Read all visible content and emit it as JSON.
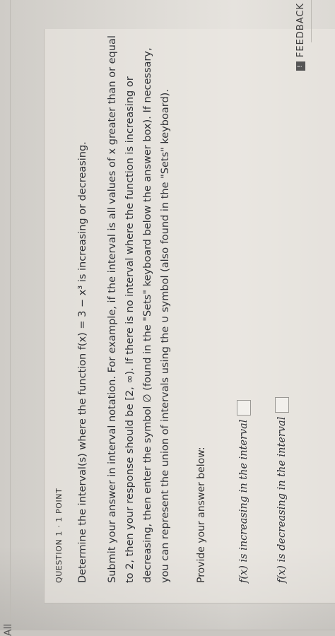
{
  "tab_label": "All",
  "question": {
    "label": "QUESTION 1 · 1 POINT",
    "prompt": "Determine the interval(s) where the function f(x) = 3 − x³ is increasing or decreasing.",
    "instructions": "Submit your answer in interval notation. For example, if the interval is all values of x greater than or equal to 2, then your response should be [2, ∞). If there is no interval where the function is increasing or decreasing, then enter the symbol ∅ (found in the \"Sets\" keyboard below the answer box). If necessary, you can represent the union of intervals using the ∪ symbol (also found in the \"Sets\" keyboard).",
    "provide_label": "Provide your answer below:",
    "answers": [
      {
        "label": "f(x) is increasing in the interval",
        "value": ""
      },
      {
        "label": "f(x) is decreasing in the interval",
        "value": ""
      }
    ]
  },
  "feedback": {
    "label": "FEEDBACK"
  }
}
